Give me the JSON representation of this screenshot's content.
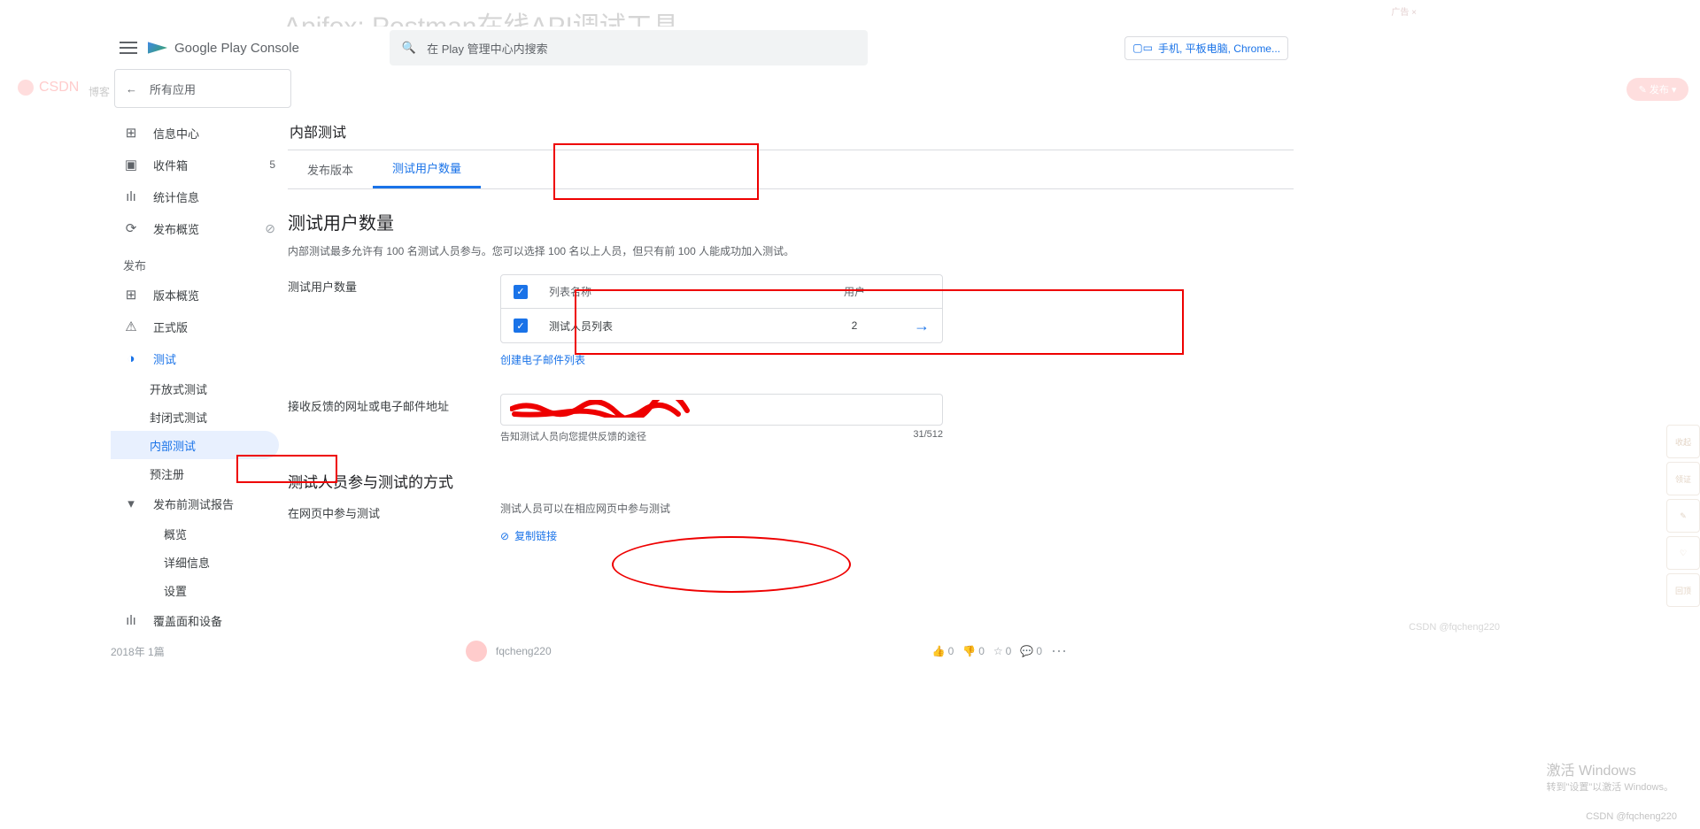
{
  "overlay": {
    "csdn": "CSDN",
    "blog": "博客",
    "ad_text": "Apifox: Postman在线API调试工具",
    "ad_tag": "广告 ×",
    "publish": "✎ 发布 ▾",
    "activate_title": "激活 Windows",
    "activate_sub": "转到\"设置\"以激活 Windows。",
    "user_wm": "CSDN @fqcheng220"
  },
  "header": {
    "logo_text": "Google Play Console",
    "search_placeholder": "在 Play 管理中心内搜索",
    "device_label": "手机, 平板电脑, Chrome..."
  },
  "back": {
    "label": "所有应用"
  },
  "sidebar": {
    "items": [
      {
        "icon": "⊞",
        "label": "信息中心"
      },
      {
        "icon": "▣",
        "label": "收件箱",
        "badge": "5"
      },
      {
        "icon": "ılı",
        "label": "统计信息"
      },
      {
        "icon": "⟳",
        "label": "发布概览",
        "strike": "⊘"
      }
    ],
    "pub_section": "发布",
    "pub_items": [
      {
        "icon": "⊞",
        "label": "版本概览"
      },
      {
        "icon": "⚠",
        "label": "正式版"
      },
      {
        "icon": "◑",
        "label": "测试",
        "active": true
      }
    ],
    "test_subs": [
      {
        "label": "开放式测试"
      },
      {
        "label": "封闭式测试"
      },
      {
        "label": "内部测试",
        "active": true
      },
      {
        "label": "预注册"
      }
    ],
    "report_item": {
      "icon": "▾",
      "label": "发布前测试报告"
    },
    "report_subs": [
      "概览",
      "详细信息",
      "设置"
    ],
    "coverage": {
      "icon": "ılı",
      "label": "覆盖面和设备"
    }
  },
  "content": {
    "page_title": "内部测试",
    "tabs": [
      {
        "label": "发布版本"
      },
      {
        "label": "测试用户数量",
        "active": true
      }
    ],
    "section_title": "测试用户数量",
    "section_desc": "内部测试最多允许有 100 名测试人员参与。您可以选择 100 名以上人员，但只有前 100 人能成功加入测试。",
    "testers_label": "测试用户数量",
    "table": {
      "head_name": "列表名称",
      "head_users": "用户",
      "row_name": "测试人员列表",
      "row_users": "2"
    },
    "create_link": "创建电子邮件列表",
    "feedback_label": "接收反馈的网址或电子邮件地址",
    "feedback_hint": "告知测试人员向您提供反馈的途径",
    "feedback_count": "31/512",
    "join_title": "测试人员参与测试的方式",
    "join_label": "在网页中参与测试",
    "join_desc": "测试人员可以在相应网页中参与测试",
    "copy_link": "复制链接"
  },
  "blog_strip": {
    "year": "2018年 1篇",
    "username": "fqcheng220",
    "like": "0",
    "dislike": "0",
    "star": "0",
    "comment": "0"
  },
  "right_rail": [
    "收起",
    "领证",
    "✎",
    "♡",
    "回顶"
  ]
}
